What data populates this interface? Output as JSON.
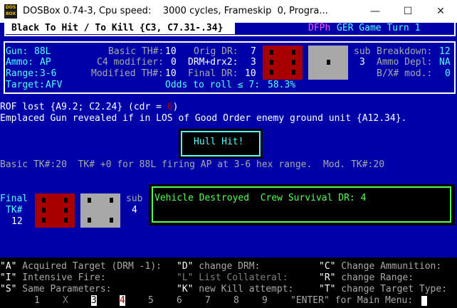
{
  "window": {
    "icon_label_top": "DOS",
    "icon_label_bottom": "BOX",
    "title": "DOSBox 0.74-3, Cpu speed:    3000 cycles, Frameskip  0, Progra...",
    "minimize": "—",
    "maximize": "☐",
    "close": "✕"
  },
  "header": {
    "title": "Black To Hit / To Kill {C3, C7.31-.34}",
    "phase": "DFPh",
    "turn": "GER Game Turn 1"
  },
  "panel": {
    "gun_label": "Gun:",
    "gun_value": "88L",
    "ammo_label": "Ammo:",
    "ammo_value": "AP",
    "range_label": "Range:",
    "range_value": "3-6",
    "target_label": "Target:",
    "target_value": "AFV",
    "basic_th_label": "Basic TH#:",
    "basic_th_value": "10",
    "c4_label": "C4 modifier:",
    "c4_value": "0",
    "mod_th_label": "Modified TH#:",
    "mod_th_value": "10",
    "orig_dr_label": "Orig DR:",
    "orig_dr_value": "7",
    "drm_label": "DRM+drx2:",
    "drm_value": "3",
    "final_dr_label": "Final DR:",
    "final_dr_value": "10",
    "sub_label": "sub",
    "sub_value": "3",
    "breakdown_label": "Breakdown:",
    "breakdown_value": "12",
    "ammo_depl_label": "Ammo Depl:",
    "ammo_depl_value": "NA",
    "bx_label": "B/X# mod.:",
    "bx_value": "0",
    "odds_label": "Odds to roll ≤ 7:",
    "odds_value": "58.3%"
  },
  "messages": {
    "rof_prefix": "ROF lost {A9.2; C2.24} (cdr = ",
    "rof_value": "6",
    "rof_suffix": ")",
    "emplaced": "Emplaced Gun revealed if in LOS of Good Order enemy ground unit {A12.34}.",
    "hull_hit": "Hull Hit!",
    "basic_tk": "Basic TK#:20  TK# +0 for 88L firing AP at 3-6 hex range.  Mod. TK#:20"
  },
  "kill": {
    "final_label": "Final",
    "tk_label": "TK#",
    "tk_value": "12",
    "sub_label": "sub",
    "sub_value": "4",
    "result": "Vehicle Destroyed  Crew Survival DR: 4"
  },
  "menu": {
    "row1": [
      {
        "key": "\"A\"",
        "text": " Acquired Target (DRM -1):"
      },
      {
        "key": "\"D\"",
        "text": " change DRM:"
      },
      {
        "key": "\"C\"",
        "text": " Change Ammunition:"
      }
    ],
    "row2": [
      {
        "key": "\"I\"",
        "text": " Intensive Fire:"
      },
      {
        "key": "\"L\"",
        "text": " List Collateral:"
      },
      {
        "key": "\"R\"",
        "text": " change Range:"
      }
    ],
    "row3": [
      {
        "key": "\"S\"",
        "text": " Same Parameters:"
      },
      {
        "key": "\"K\"",
        "text": " new Kill attempt:"
      },
      {
        "key": "\"T\"",
        "text": " change Target Type:"
      }
    ],
    "numbers": [
      "1",
      "X",
      "3",
      "4",
      "5",
      "6",
      "7",
      "8",
      "9"
    ],
    "enter": "\"ENTER\" for Main Menu:"
  },
  "colors": {
    "dos_blue": "#0000a8",
    "cyan": "#55ffff",
    "magenta": "#ff55ff",
    "yellow": "#ffff55",
    "dark_red": "#a80000",
    "green": "#55ff55"
  },
  "dice": {
    "to_hit_colored": 6,
    "to_hit_white": 1,
    "to_kill_colored": 6,
    "to_kill_white": 4
  }
}
